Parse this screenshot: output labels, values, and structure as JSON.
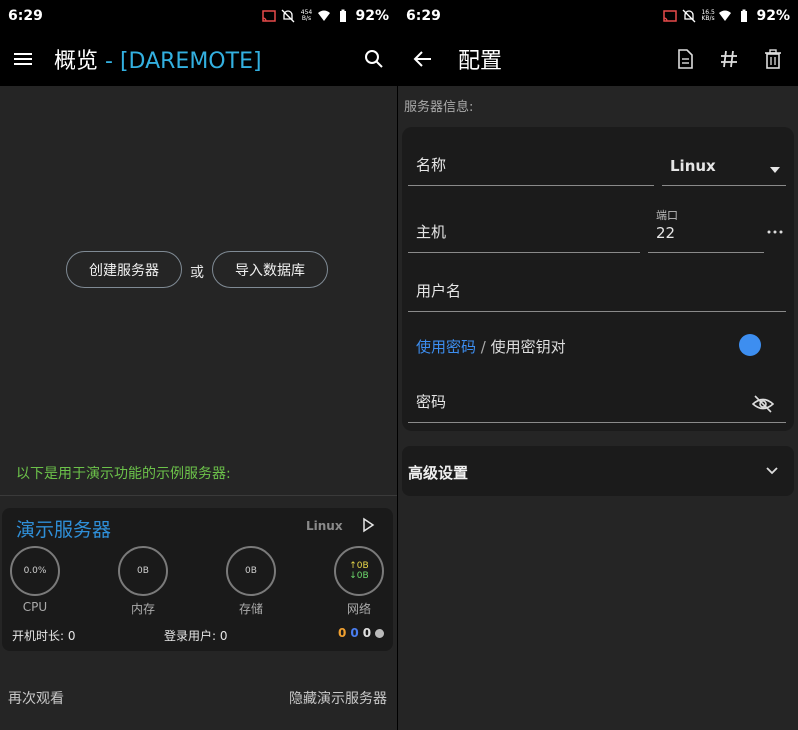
{
  "left": {
    "status": {
      "time": "6:29",
      "speed_top": "454",
      "speed_bottom": "B/s",
      "battery": "92%"
    },
    "appbar": {
      "title": "概览",
      "separator": " - ",
      "subtitle": "[DAREMOTE]"
    },
    "actions": {
      "create": "创建服务器",
      "or": "或",
      "import": "导入数据库"
    },
    "demo_note": "以下是用于演示功能的示例服务器:",
    "card": {
      "title": "演示服务器",
      "os": "Linux",
      "gauges": [
        {
          "value": "0.0%",
          "label": "CPU"
        },
        {
          "value": "0B",
          "label": "内存"
        },
        {
          "value": "0B",
          "label": "存储"
        },
        {
          "up": "↑0B",
          "down": "↓0B",
          "label": "网络"
        }
      ],
      "uptime": "开机时长: 0",
      "users": "登录用户: 0",
      "counts": [
        "0",
        "0",
        "0"
      ],
      "count_colors": [
        "#f0a030",
        "#4a7ef0",
        "#e0e0e0"
      ]
    },
    "links": {
      "review": "再次观看",
      "hide": "隐藏演示服务器"
    }
  },
  "right": {
    "status": {
      "time": "6:29",
      "speed_top": "16.5",
      "speed_bottom": "KB/s",
      "battery": "92%"
    },
    "appbar": {
      "title": "配置"
    },
    "section_label": "服务器信息:",
    "fields": {
      "name": "名称",
      "os_select": "Linux",
      "host": "主机",
      "port_label": "端口",
      "port_value": "22",
      "username": "用户名",
      "auth_password": "使用密码",
      "auth_sep": " / ",
      "auth_keypair": "使用密钥对",
      "password": "密码"
    },
    "advanced": "高级设置"
  },
  "colors": {
    "accent": "#2f8fd8",
    "green": "#6cc24a",
    "toggle": "#3d8ef0"
  }
}
